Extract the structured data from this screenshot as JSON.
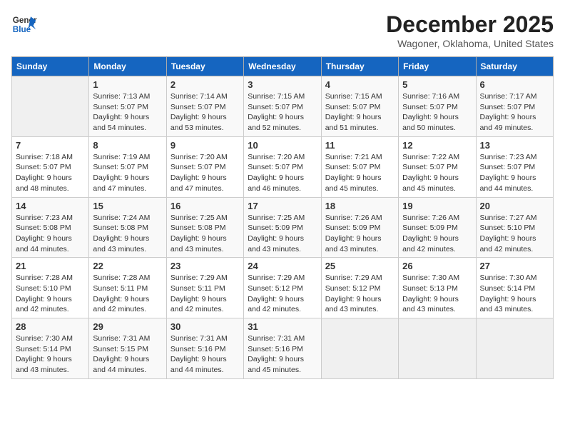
{
  "header": {
    "logo_line1": "General",
    "logo_line2": "Blue",
    "month": "December 2025",
    "location": "Wagoner, Oklahoma, United States"
  },
  "weekdays": [
    "Sunday",
    "Monday",
    "Tuesday",
    "Wednesday",
    "Thursday",
    "Friday",
    "Saturday"
  ],
  "weeks": [
    [
      {
        "day": "",
        "info": ""
      },
      {
        "day": "1",
        "info": "Sunrise: 7:13 AM\nSunset: 5:07 PM\nDaylight: 9 hours\nand 54 minutes."
      },
      {
        "day": "2",
        "info": "Sunrise: 7:14 AM\nSunset: 5:07 PM\nDaylight: 9 hours\nand 53 minutes."
      },
      {
        "day": "3",
        "info": "Sunrise: 7:15 AM\nSunset: 5:07 PM\nDaylight: 9 hours\nand 52 minutes."
      },
      {
        "day": "4",
        "info": "Sunrise: 7:15 AM\nSunset: 5:07 PM\nDaylight: 9 hours\nand 51 minutes."
      },
      {
        "day": "5",
        "info": "Sunrise: 7:16 AM\nSunset: 5:07 PM\nDaylight: 9 hours\nand 50 minutes."
      },
      {
        "day": "6",
        "info": "Sunrise: 7:17 AM\nSunset: 5:07 PM\nDaylight: 9 hours\nand 49 minutes."
      }
    ],
    [
      {
        "day": "7",
        "info": "Sunrise: 7:18 AM\nSunset: 5:07 PM\nDaylight: 9 hours\nand 48 minutes."
      },
      {
        "day": "8",
        "info": "Sunrise: 7:19 AM\nSunset: 5:07 PM\nDaylight: 9 hours\nand 47 minutes."
      },
      {
        "day": "9",
        "info": "Sunrise: 7:20 AM\nSunset: 5:07 PM\nDaylight: 9 hours\nand 47 minutes."
      },
      {
        "day": "10",
        "info": "Sunrise: 7:20 AM\nSunset: 5:07 PM\nDaylight: 9 hours\nand 46 minutes."
      },
      {
        "day": "11",
        "info": "Sunrise: 7:21 AM\nSunset: 5:07 PM\nDaylight: 9 hours\nand 45 minutes."
      },
      {
        "day": "12",
        "info": "Sunrise: 7:22 AM\nSunset: 5:07 PM\nDaylight: 9 hours\nand 45 minutes."
      },
      {
        "day": "13",
        "info": "Sunrise: 7:23 AM\nSunset: 5:07 PM\nDaylight: 9 hours\nand 44 minutes."
      }
    ],
    [
      {
        "day": "14",
        "info": "Sunrise: 7:23 AM\nSunset: 5:08 PM\nDaylight: 9 hours\nand 44 minutes."
      },
      {
        "day": "15",
        "info": "Sunrise: 7:24 AM\nSunset: 5:08 PM\nDaylight: 9 hours\nand 43 minutes."
      },
      {
        "day": "16",
        "info": "Sunrise: 7:25 AM\nSunset: 5:08 PM\nDaylight: 9 hours\nand 43 minutes."
      },
      {
        "day": "17",
        "info": "Sunrise: 7:25 AM\nSunset: 5:09 PM\nDaylight: 9 hours\nand 43 minutes."
      },
      {
        "day": "18",
        "info": "Sunrise: 7:26 AM\nSunset: 5:09 PM\nDaylight: 9 hours\nand 43 minutes."
      },
      {
        "day": "19",
        "info": "Sunrise: 7:26 AM\nSunset: 5:09 PM\nDaylight: 9 hours\nand 42 minutes."
      },
      {
        "day": "20",
        "info": "Sunrise: 7:27 AM\nSunset: 5:10 PM\nDaylight: 9 hours\nand 42 minutes."
      }
    ],
    [
      {
        "day": "21",
        "info": "Sunrise: 7:28 AM\nSunset: 5:10 PM\nDaylight: 9 hours\nand 42 minutes."
      },
      {
        "day": "22",
        "info": "Sunrise: 7:28 AM\nSunset: 5:11 PM\nDaylight: 9 hours\nand 42 minutes."
      },
      {
        "day": "23",
        "info": "Sunrise: 7:29 AM\nSunset: 5:11 PM\nDaylight: 9 hours\nand 42 minutes."
      },
      {
        "day": "24",
        "info": "Sunrise: 7:29 AM\nSunset: 5:12 PM\nDaylight: 9 hours\nand 42 minutes."
      },
      {
        "day": "25",
        "info": "Sunrise: 7:29 AM\nSunset: 5:12 PM\nDaylight: 9 hours\nand 43 minutes."
      },
      {
        "day": "26",
        "info": "Sunrise: 7:30 AM\nSunset: 5:13 PM\nDaylight: 9 hours\nand 43 minutes."
      },
      {
        "day": "27",
        "info": "Sunrise: 7:30 AM\nSunset: 5:14 PM\nDaylight: 9 hours\nand 43 minutes."
      }
    ],
    [
      {
        "day": "28",
        "info": "Sunrise: 7:30 AM\nSunset: 5:14 PM\nDaylight: 9 hours\nand 43 minutes."
      },
      {
        "day": "29",
        "info": "Sunrise: 7:31 AM\nSunset: 5:15 PM\nDaylight: 9 hours\nand 44 minutes."
      },
      {
        "day": "30",
        "info": "Sunrise: 7:31 AM\nSunset: 5:16 PM\nDaylight: 9 hours\nand 44 minutes."
      },
      {
        "day": "31",
        "info": "Sunrise: 7:31 AM\nSunset: 5:16 PM\nDaylight: 9 hours\nand 45 minutes."
      },
      {
        "day": "",
        "info": ""
      },
      {
        "day": "",
        "info": ""
      },
      {
        "day": "",
        "info": ""
      }
    ]
  ]
}
